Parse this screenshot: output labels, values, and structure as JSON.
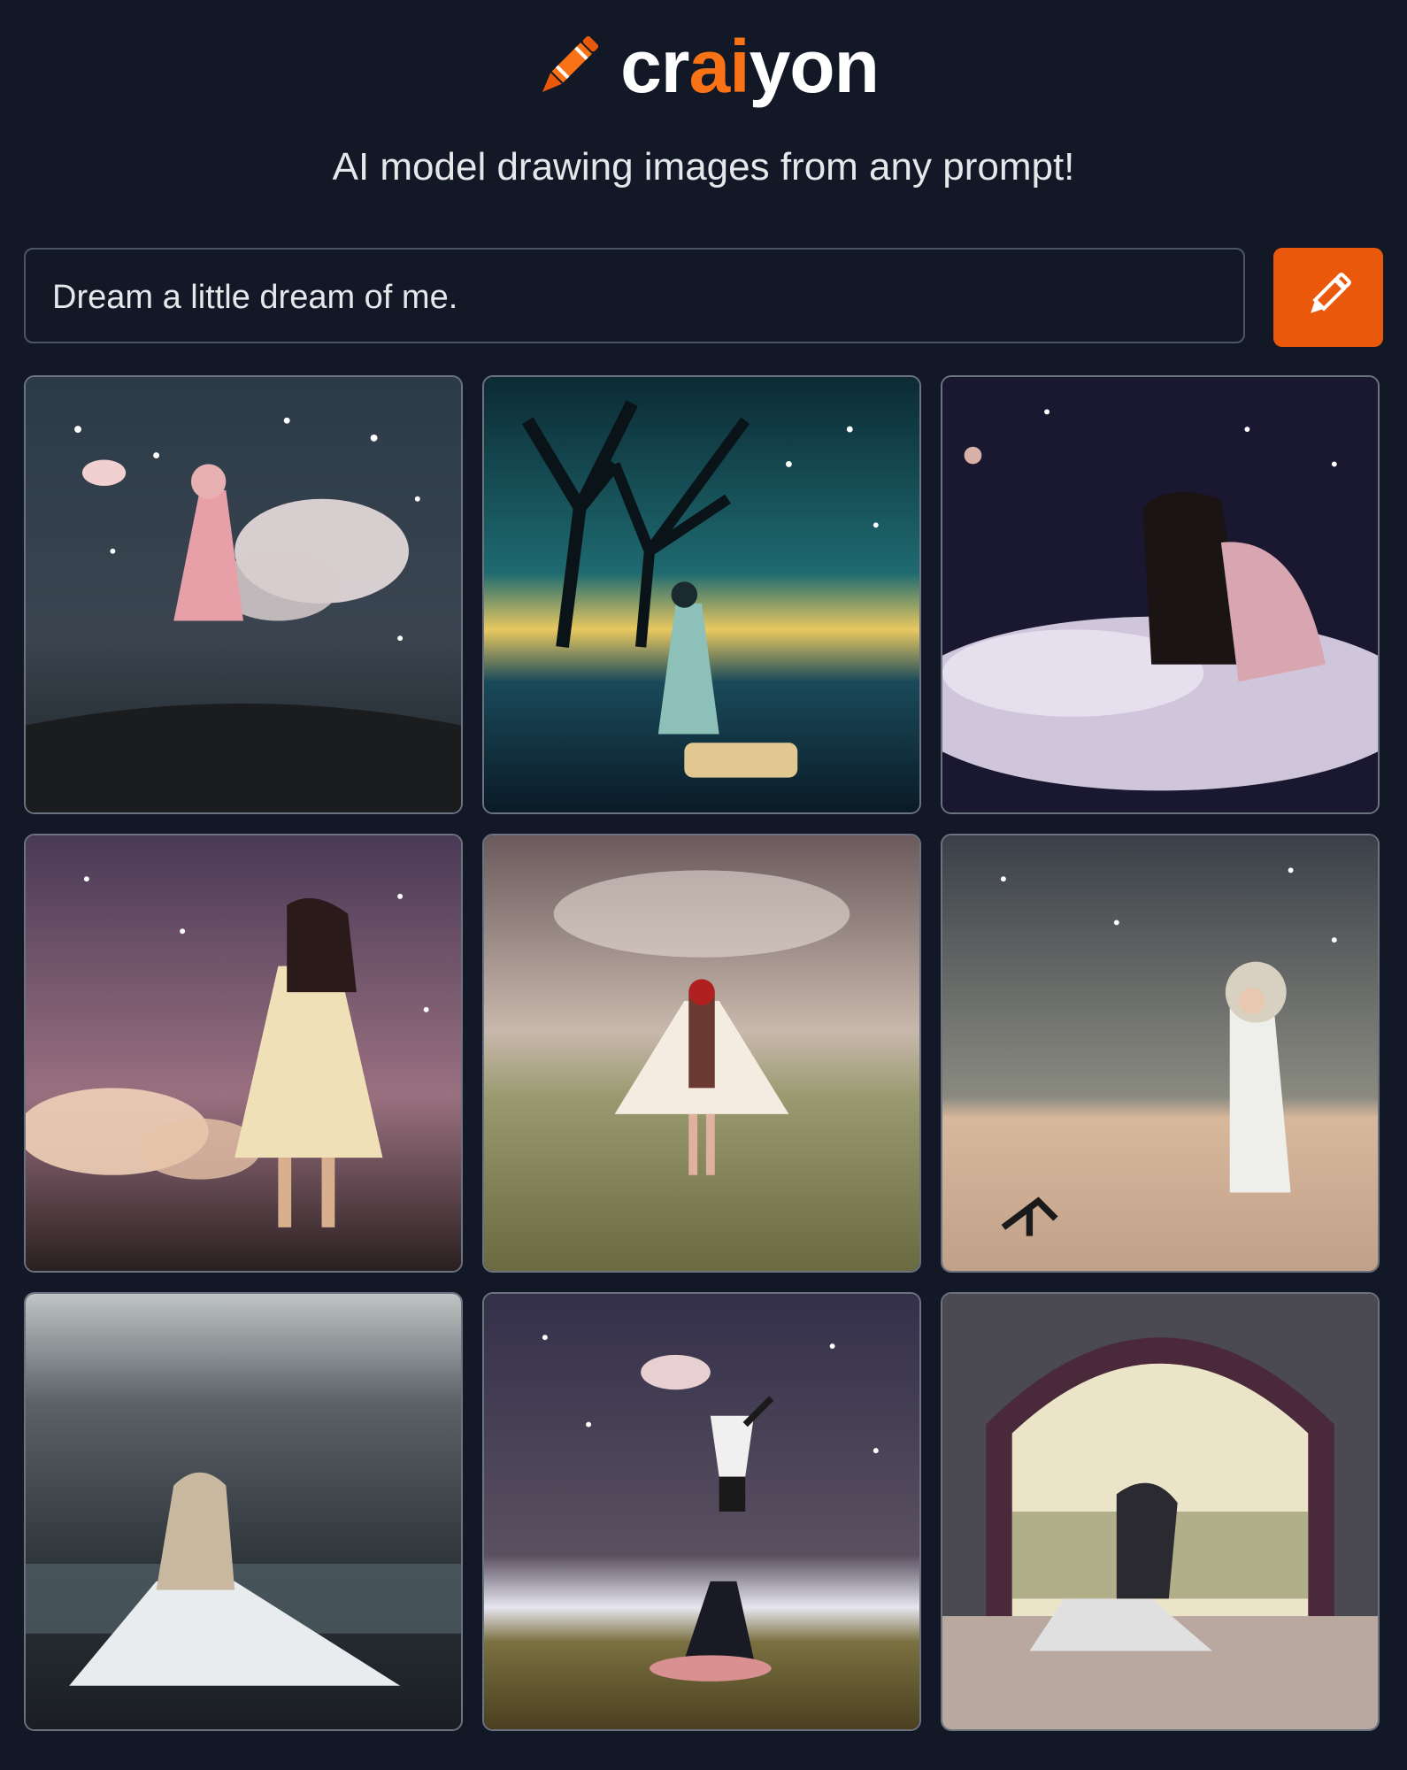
{
  "header": {
    "logo": {
      "prefix": "cr",
      "accent": "ai",
      "suffix": "yon",
      "accent_color": "#f97316"
    },
    "tagline": "AI model drawing images from any prompt!"
  },
  "prompt": {
    "value": "Dream a little dream of me.",
    "button_icon": "pencil-icon",
    "button_color": "#ea580c"
  },
  "results": {
    "count": 9,
    "images": [
      {
        "subject": "girl floating among clouds and stars"
      },
      {
        "subject": "girl under glowing tree at night"
      },
      {
        "subject": "girl lying on a cloud"
      },
      {
        "subject": "girl in white dress before pink clouds"
      },
      {
        "subject": "girl in white dress in foggy field"
      },
      {
        "subject": "child in white robe on beige plain"
      },
      {
        "subject": "girl in white gown facing the sea"
      },
      {
        "subject": "figures under starry purple sky"
      },
      {
        "subject": "girl on a bed beneath an arch"
      }
    ]
  }
}
